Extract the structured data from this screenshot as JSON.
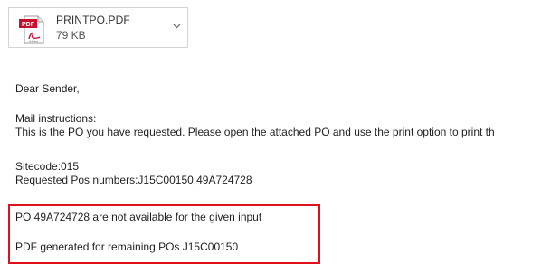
{
  "attachment": {
    "filename": "PRINTPO.PDF",
    "size": "79 KB",
    "icon": "pdf-file-icon",
    "icon_badge": "PDF",
    "icon_brand": "Adobe",
    "badge_color": "#c8102e"
  },
  "email_body": {
    "greeting": "Dear Sender,",
    "instructions_heading": "Mail instructions:",
    "instructions_text": "This is the PO you have requested. Please open the attached PO and use the print option to print th",
    "sitecode": "Sitecode:015",
    "requested_pos": "Requested Pos numbers:J15C00150,49A724728",
    "not_available": "PO 49A724728 are not available for the given input",
    "pdf_generated": "PDF generated for remaining POs J15C00150"
  },
  "highlight_color": "#e0101a"
}
